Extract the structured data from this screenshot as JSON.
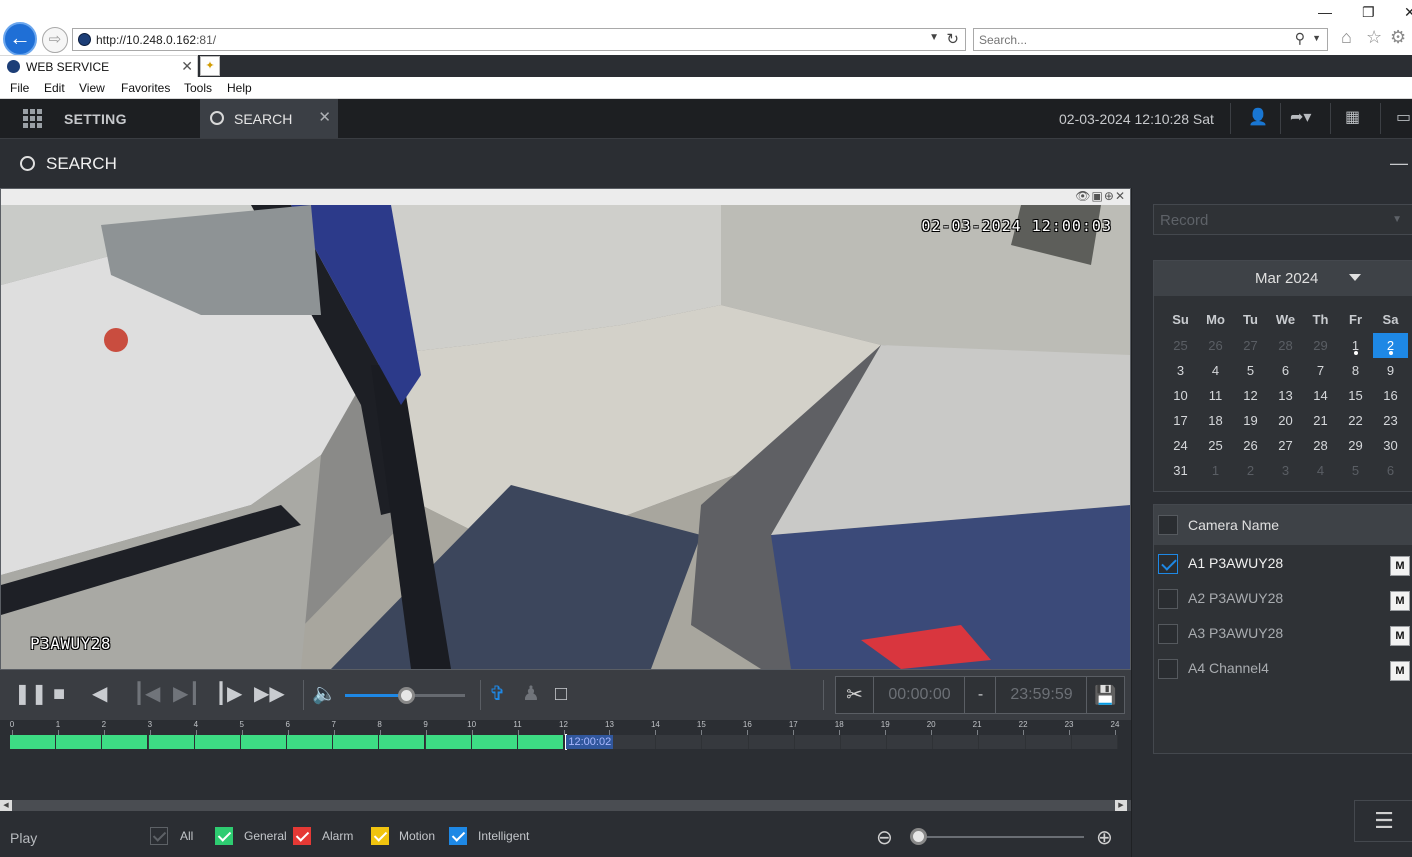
{
  "browser": {
    "url_host": "http://10.248.0.162",
    "url_rest": ":81/",
    "search_placeholder": "Search...",
    "tab_title": "WEB SERVICE",
    "menu": [
      "File",
      "Edit",
      "View",
      "Favorites",
      "Tools",
      "Help"
    ]
  },
  "header": {
    "setting_label": "SETTING",
    "search_tab_label": "SEARCH",
    "datetime": "02-03-2024 12:10:28 Sat",
    "page_title": "SEARCH"
  },
  "video": {
    "osd_timestamp": "02-03-2024 12:00:03",
    "osd_camera": "P3AWUY28"
  },
  "controls": {
    "volume_level": 0.52,
    "clip_start": "00:00:00",
    "clip_separator": "-",
    "clip_end": "23:59:59"
  },
  "timeline": {
    "hours": [
      "0",
      "1",
      "2",
      "3",
      "4",
      "5",
      "6",
      "7",
      "8",
      "9",
      "10",
      "11",
      "12",
      "13",
      "14",
      "15",
      "16",
      "17",
      "18",
      "19",
      "20",
      "21",
      "22",
      "23",
      "24"
    ],
    "recorded_until_hour": 12.03,
    "cursor_label": "12:00:02"
  },
  "legend": {
    "play_label": "Play",
    "items": [
      {
        "label": "All",
        "color": "#5d6166"
      },
      {
        "label": "General",
        "color": "#2ecc71"
      },
      {
        "label": "Alarm",
        "color": "#e53935"
      },
      {
        "label": "Motion",
        "color": "#f1c40f"
      },
      {
        "label": "Intelligent",
        "color": "#1e88e5"
      }
    ],
    "zoom_level": 0.0
  },
  "panel": {
    "record_type": "Record",
    "calendar": {
      "month_label": "Mar 2024",
      "dow": [
        "Su",
        "Mo",
        "Tu",
        "We",
        "Th",
        "Fr",
        "Sa"
      ],
      "weeks": [
        [
          "25",
          "26",
          "27",
          "28",
          "29",
          "1",
          "2"
        ],
        [
          "3",
          "4",
          "5",
          "6",
          "7",
          "8",
          "9"
        ],
        [
          "10",
          "11",
          "12",
          "13",
          "14",
          "15",
          "16"
        ],
        [
          "17",
          "18",
          "19",
          "20",
          "21",
          "22",
          "23"
        ],
        [
          "24",
          "25",
          "26",
          "27",
          "28",
          "29",
          "30"
        ],
        [
          "31",
          "1",
          "2",
          "3",
          "4",
          "5",
          "6"
        ]
      ],
      "selected_day": "2",
      "days_with_records": [
        "1",
        "2"
      ]
    },
    "camera_header": "Camera Name",
    "cameras": [
      {
        "name": "A1 P3AWUY28",
        "checked": true,
        "m": "M"
      },
      {
        "name": "A2 P3AWUY28",
        "checked": false,
        "m": "M"
      },
      {
        "name": "A3 P3AWUY28",
        "checked": false,
        "m": "M"
      },
      {
        "name": "A4 Channel4",
        "checked": false,
        "m": "M"
      }
    ],
    "accent_color": "#1e88e5"
  }
}
